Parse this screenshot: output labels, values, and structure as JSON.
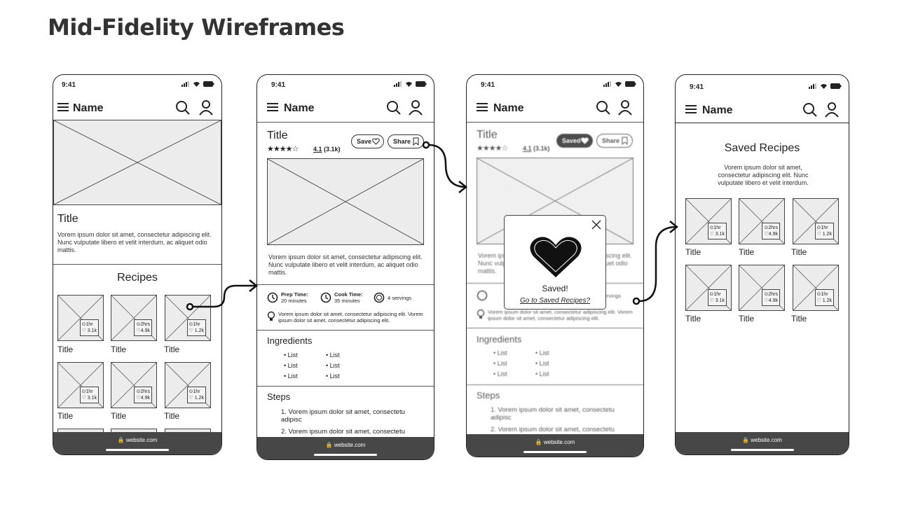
{
  "page_title": "Mid-Fidelity Wireframes",
  "status_time": "9:41",
  "app_name": "Name",
  "footer_url": "🔒 website.com",
  "screen1": {
    "title": "Title",
    "description": "Vorem ipsum dolor sit amet, consectetur adipiscing elit. Nunc vulputate libero et velit interdum, ac aliquet odio mattis.",
    "section_heading": "Recipes",
    "tiles": [
      {
        "title": "Title",
        "time": "⊙1hr",
        "likes": "♡ 3.1k"
      },
      {
        "title": "Title",
        "time": "⊙2hrs",
        "likes": "♡4.9k"
      },
      {
        "title": "Title",
        "time": "⊙1hr",
        "likes": "♡ 1.2k"
      },
      {
        "title": "Title",
        "time": "⊙1hr",
        "likes": "♡ 3.1k"
      },
      {
        "title": "Title",
        "time": "⊙2hrs",
        "likes": "♡4.9k"
      },
      {
        "title": "Title",
        "time": "⊙1hr",
        "likes": "♡ 1.2k"
      }
    ]
  },
  "screen2": {
    "title": "Title",
    "stars": "★★★★☆",
    "rating_value": "4.1",
    "rating_count": "(3.1k)",
    "save_label": "Save",
    "share_label": "Share",
    "description": "Vorem ipsum dolor sit amet, consectetur adipiscing elit. Nunc vulputate libero et velit interdum, ac aliquet odio mattis.",
    "prep_label": "Prep Time:",
    "prep_value": "20 minutes",
    "cook_label": "Cook Time:",
    "cook_value": "35 minutes",
    "servings": "4 servings",
    "tip": "Vorem ipsum dolor sit amet, consectetur adipiscing elit. Vorem ipsum dolor sit amet, consectetur adipiscing elit.",
    "ingredients_heading": "Ingredients",
    "list_item": "List",
    "steps_heading": "Steps",
    "step1": "1. Vorem ipsum dolor sit amet, consectetu adipisc",
    "step2": "2. Vorem ipsum dolor sit amet, consectetu"
  },
  "screen3": {
    "saved_label": "Saved",
    "modal_title": "Saved!",
    "modal_link": "Go to Saved Recipes?"
  },
  "screen4": {
    "heading": "Saved Recipes",
    "description": "Vorem ipsum dolor sit amet, consectetur adipiscing elit. Nunc vulputate libero et velit interdum."
  }
}
